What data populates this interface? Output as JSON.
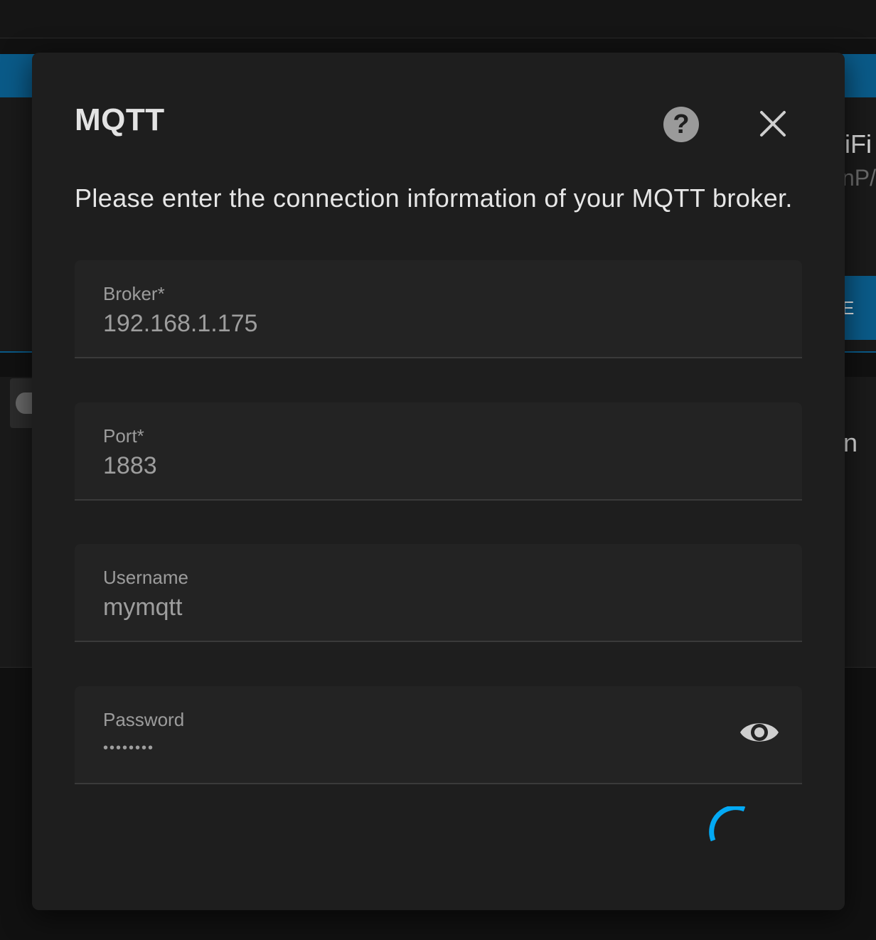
{
  "background": {
    "partial_text_1": "iFi",
    "partial_text_2": "nP/",
    "button_label": "E",
    "partial_text_3": "n"
  },
  "dialog": {
    "title": "MQTT",
    "help_icon": "help-icon",
    "close_icon": "close-icon",
    "description": "Please enter the connection information of your MQTT broker.",
    "fields": {
      "broker": {
        "label": "Broker*",
        "value": "192.168.1.175"
      },
      "port": {
        "label": "Port*",
        "value": "1883"
      },
      "username": {
        "label": "Username",
        "value": "mymqtt"
      },
      "password": {
        "label": "Password",
        "value": "••••••••",
        "toggle_icon": "eye-icon"
      }
    },
    "status": {
      "loading": true,
      "spinner_color": "#03a9f4"
    }
  },
  "colors": {
    "dialog_bg": "#1e1e1e",
    "accent": "#03a9f4",
    "field_bg": "#232323"
  }
}
